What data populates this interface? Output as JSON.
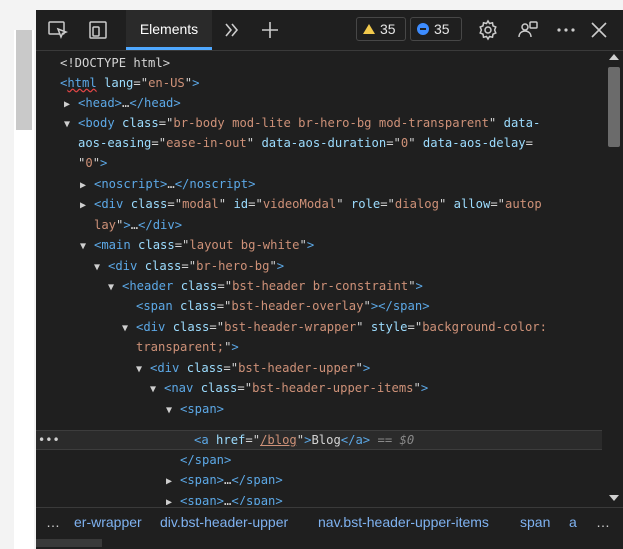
{
  "toolbar": {
    "tab_elements": "Elements",
    "warnings_count": "35",
    "messages_count": "35"
  },
  "code_lines": [
    {
      "id": "l01",
      "parts": [
        {
          "t": "<!DOCTYPE html>",
          "c": "txt"
        }
      ]
    },
    {
      "id": "l02",
      "parts": [
        {
          "t": "<",
          "c": "tag"
        },
        {
          "t": "html",
          "c": "tag wavy"
        },
        {
          "t": " lang",
          "c": "attr"
        },
        {
          "t": "=\"",
          "c": "txt"
        },
        {
          "t": "en-US",
          "c": "val"
        },
        {
          "t": "\"",
          "c": "txt"
        },
        {
          "t": ">",
          "c": "tag"
        }
      ]
    },
    {
      "id": "l03",
      "parts": [
        {
          "t": "<head>",
          "c": "tag"
        },
        {
          "t": "…",
          "c": "txt"
        },
        {
          "t": "</head>",
          "c": "tag"
        }
      ]
    },
    {
      "id": "l04",
      "parts": [
        {
          "t": "<body",
          "c": "tag"
        },
        {
          "t": " class",
          "c": "attr"
        },
        {
          "t": "=\"",
          "c": "txt"
        },
        {
          "t": "br-body mod-lite br-hero-bg mod-transparent",
          "c": "val"
        },
        {
          "t": "\"",
          "c": "txt"
        },
        {
          "t": " data-",
          "c": "attr"
        }
      ]
    },
    {
      "id": "l05",
      "parts": [
        {
          "t": "aos-easing",
          "c": "attr"
        },
        {
          "t": "=\"",
          "c": "txt"
        },
        {
          "t": "ease-in-out",
          "c": "val"
        },
        {
          "t": "\"",
          "c": "txt"
        },
        {
          "t": " data-aos-duration",
          "c": "attr"
        },
        {
          "t": "=\"",
          "c": "txt"
        },
        {
          "t": "0",
          "c": "val"
        },
        {
          "t": "\"",
          "c": "txt"
        },
        {
          "t": " data-aos-delay",
          "c": "attr"
        },
        {
          "t": "=",
          "c": "txt"
        }
      ]
    },
    {
      "id": "l06",
      "parts": [
        {
          "t": "\"",
          "c": "txt"
        },
        {
          "t": "0",
          "c": "val"
        },
        {
          "t": "\"",
          "c": "txt"
        },
        {
          "t": ">",
          "c": "tag"
        }
      ]
    },
    {
      "id": "l07",
      "parts": [
        {
          "t": "<noscript>",
          "c": "tag"
        },
        {
          "t": "…",
          "c": "txt"
        },
        {
          "t": "</noscript>",
          "c": "tag"
        }
      ]
    },
    {
      "id": "l08",
      "parts": [
        {
          "t": "<div",
          "c": "tag"
        },
        {
          "t": " class",
          "c": "attr"
        },
        {
          "t": "=\"",
          "c": "txt"
        },
        {
          "t": "modal",
          "c": "val"
        },
        {
          "t": "\"",
          "c": "txt"
        },
        {
          "t": " id",
          "c": "attr"
        },
        {
          "t": "=\"",
          "c": "txt"
        },
        {
          "t": "videoModal",
          "c": "val"
        },
        {
          "t": "\"",
          "c": "txt"
        },
        {
          "t": " role",
          "c": "attr"
        },
        {
          "t": "=\"",
          "c": "txt"
        },
        {
          "t": "dialog",
          "c": "val"
        },
        {
          "t": "\"",
          "c": "txt"
        },
        {
          "t": " allow",
          "c": "attr"
        },
        {
          "t": "=\"",
          "c": "txt"
        },
        {
          "t": "autop",
          "c": "val"
        }
      ]
    },
    {
      "id": "l09",
      "parts": [
        {
          "t": "lay",
          "c": "val"
        },
        {
          "t": "\"",
          "c": "txt"
        },
        {
          "t": ">",
          "c": "tag"
        },
        {
          "t": "…",
          "c": "txt"
        },
        {
          "t": "</div>",
          "c": "tag"
        }
      ]
    },
    {
      "id": "l10",
      "parts": [
        {
          "t": "<main",
          "c": "tag"
        },
        {
          "t": " class",
          "c": "attr"
        },
        {
          "t": "=\"",
          "c": "txt"
        },
        {
          "t": "layout bg-white",
          "c": "val"
        },
        {
          "t": "\"",
          "c": "txt"
        },
        {
          "t": ">",
          "c": "tag"
        }
      ]
    },
    {
      "id": "l11",
      "parts": [
        {
          "t": "<div",
          "c": "tag"
        },
        {
          "t": " class",
          "c": "attr"
        },
        {
          "t": "=\"",
          "c": "txt"
        },
        {
          "t": "br-hero-bg",
          "c": "val"
        },
        {
          "t": "\"",
          "c": "txt"
        },
        {
          "t": ">",
          "c": "tag"
        }
      ]
    },
    {
      "id": "l12",
      "parts": [
        {
          "t": "<header",
          "c": "tag"
        },
        {
          "t": " class",
          "c": "attr"
        },
        {
          "t": "=\"",
          "c": "txt"
        },
        {
          "t": "bst-header br-constraint",
          "c": "val"
        },
        {
          "t": "\"",
          "c": "txt"
        },
        {
          "t": ">",
          "c": "tag"
        }
      ]
    },
    {
      "id": "l13",
      "parts": [
        {
          "t": "<span",
          "c": "tag"
        },
        {
          "t": " class",
          "c": "attr"
        },
        {
          "t": "=\"",
          "c": "txt"
        },
        {
          "t": "bst-header-overlay",
          "c": "val"
        },
        {
          "t": "\"",
          "c": "txt"
        },
        {
          "t": "></span>",
          "c": "tag"
        }
      ]
    },
    {
      "id": "l14",
      "parts": [
        {
          "t": "<div",
          "c": "tag"
        },
        {
          "t": " class",
          "c": "attr"
        },
        {
          "t": "=\"",
          "c": "txt"
        },
        {
          "t": "bst-header-wrapper",
          "c": "val"
        },
        {
          "t": "\"",
          "c": "txt"
        },
        {
          "t": " style",
          "c": "attr"
        },
        {
          "t": "=\"",
          "c": "txt"
        },
        {
          "t": "background-color:",
          "c": "val"
        }
      ]
    },
    {
      "id": "l15",
      "parts": [
        {
          "t": "transparent;",
          "c": "val"
        },
        {
          "t": "\"",
          "c": "txt"
        },
        {
          "t": ">",
          "c": "tag"
        }
      ]
    },
    {
      "id": "l16",
      "parts": [
        {
          "t": "<div",
          "c": "tag"
        },
        {
          "t": " class",
          "c": "attr"
        },
        {
          "t": "=\"",
          "c": "txt"
        },
        {
          "t": "bst-header-upper",
          "c": "val"
        },
        {
          "t": "\"",
          "c": "txt"
        },
        {
          "t": ">",
          "c": "tag"
        }
      ]
    },
    {
      "id": "l17",
      "parts": [
        {
          "t": "<nav",
          "c": "tag"
        },
        {
          "t": " class",
          "c": "attr"
        },
        {
          "t": "=\"",
          "c": "txt"
        },
        {
          "t": "bst-header-upper-items",
          "c": "val"
        },
        {
          "t": "\"",
          "c": "txt"
        },
        {
          "t": ">",
          "c": "tag"
        }
      ]
    },
    {
      "id": "l18",
      "parts": [
        {
          "t": "<span>",
          "c": "tag"
        }
      ]
    },
    {
      "id": "l19",
      "parts": [
        {
          "t": "<a",
          "c": "tag"
        },
        {
          "t": " href",
          "c": "attr"
        },
        {
          "t": "=\"",
          "c": "txt"
        },
        {
          "t": "/blog",
          "c": "val link-u"
        },
        {
          "t": "\"",
          "c": "txt"
        },
        {
          "t": ">",
          "c": "tag"
        },
        {
          "t": "Blog",
          "c": "txt"
        },
        {
          "t": "</a>",
          "c": "tag"
        },
        {
          "t": " == $0",
          "c": "eq"
        }
      ]
    },
    {
      "id": "l20",
      "parts": [
        {
          "t": "</span>",
          "c": "tag"
        }
      ]
    },
    {
      "id": "l21",
      "parts": [
        {
          "t": "<span>",
          "c": "tag"
        },
        {
          "t": "…",
          "c": "txt"
        },
        {
          "t": "</span>",
          "c": "tag"
        }
      ]
    },
    {
      "id": "l22",
      "parts": [
        {
          "t": "<span>",
          "c": "tag"
        },
        {
          "t": "…",
          "c": "txt"
        },
        {
          "t": "</span>",
          "c": "tag"
        }
      ]
    }
  ],
  "selected_row_dots": "•••",
  "breadcrumbs": {
    "more_left": "…",
    "items": [
      "er-wrapper",
      "div.bst-header-upper",
      "nav.bst-header-upper-items",
      "span",
      "a"
    ],
    "more_right": "…"
  },
  "colors": {
    "panel_bg": "#1f1f1f",
    "tag": "#5ca8e6",
    "attr": "#9cdcfe",
    "value": "#ce9178",
    "accent": "#4fa8ff"
  }
}
